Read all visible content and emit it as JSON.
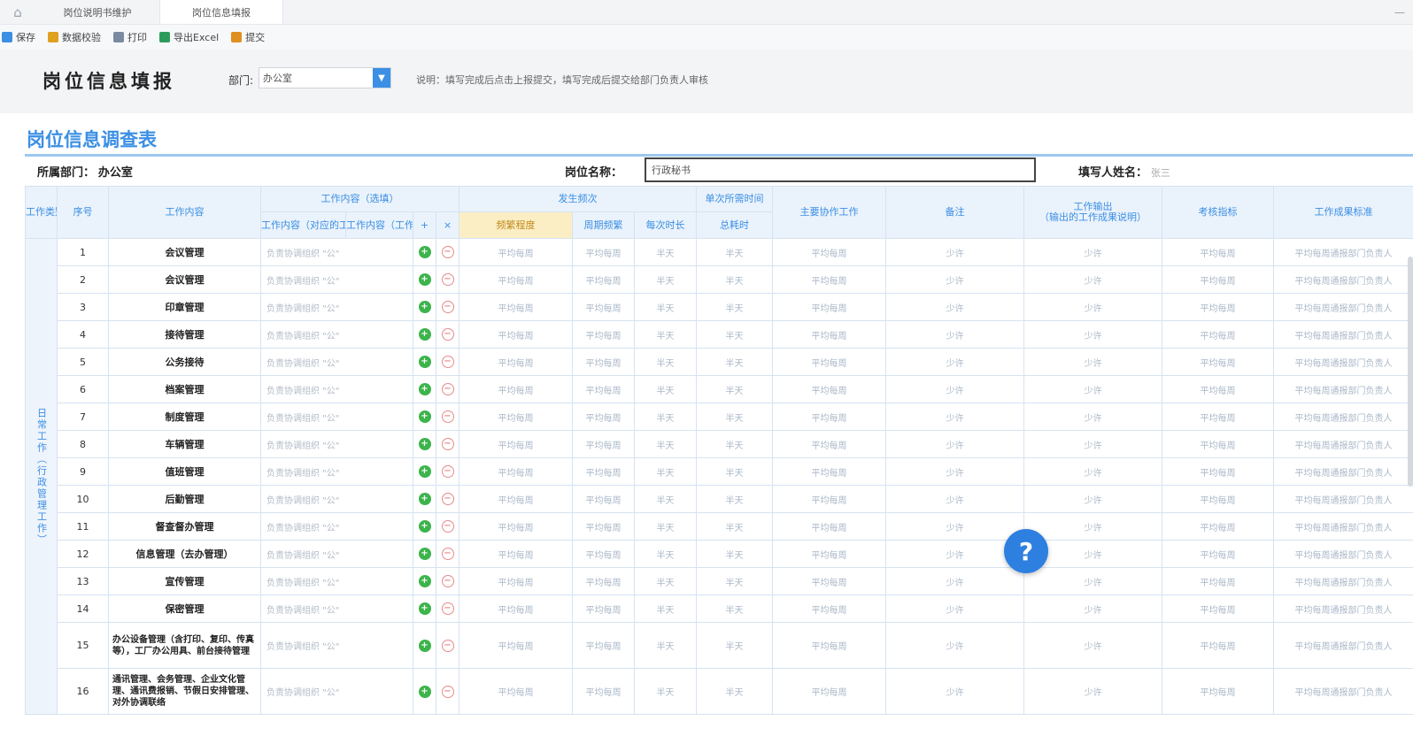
{
  "tabs": [
    {
      "label": "岗位说明书维护"
    },
    {
      "label": "岗位信息填报"
    }
  ],
  "toolbar": [
    {
      "label": "保存",
      "color": "#3b8fe4"
    },
    {
      "label": "数据校验",
      "color": "#e0a020"
    },
    {
      "label": "打印",
      "color": "#7a8aa0"
    },
    {
      "label": "导出Excel",
      "color": "#2e9b5b"
    },
    {
      "label": "提交",
      "color": "#e09020"
    }
  ],
  "filter": {
    "title": "岗位信息填报",
    "dept_label": "部门:",
    "dept_value": "办公室",
    "hint": "说明：填写完成后点击上报提交，填写完成后提交给部门负责人审核"
  },
  "form": {
    "title": "岗位信息调查表",
    "dept_label": "所属部门：",
    "dept_value": "办公室",
    "post_label": "岗位名称：",
    "post_value": "行政秘书",
    "filler_label": "填写人姓名：",
    "filler_value": "张三"
  },
  "table": {
    "headers": {
      "group": "工作类别",
      "seq": "序号",
      "content": "工作内容",
      "detail_top": "工作内容（选填）",
      "detail_a": "工作内容（对应的工作）",
      "detail_b": "工作内容（工作描述）",
      "add": "+",
      "del": "×",
      "freq_top": "发生频次",
      "freq_a": "频繁程度",
      "freq_b": "周期频繁",
      "freq_c": "每次时长",
      "load_top": "单次所需时间",
      "load_sub": "总耗时",
      "related": "主要协作工作",
      "remark": "备注",
      "result_top": "工作输出",
      "result_sub": "（输出的工作成果说明）",
      "assess": "考核指标",
      "result": "工作成果标准"
    },
    "group_label": "日常工作（行政管理工作）",
    "rows": [
      {
        "seq": "1",
        "name": "会议管理",
        "desc": "负责协调组织 \"公\""
      },
      {
        "seq": "2",
        "name": "会议管理",
        "desc": "负责协调组织 \"公\""
      },
      {
        "seq": "3",
        "name": "印章管理",
        "desc": "负责协调组织 \"公\""
      },
      {
        "seq": "4",
        "name": "接待管理",
        "desc": "负责协调组织 \"公\""
      },
      {
        "seq": "5",
        "name": "公务接待",
        "desc": "负责协调组织 \"公\""
      },
      {
        "seq": "6",
        "name": "档案管理",
        "desc": "负责协调组织 \"公\""
      },
      {
        "seq": "7",
        "name": "制度管理",
        "desc": "负责协调组织 \"公\""
      },
      {
        "seq": "8",
        "name": "车辆管理",
        "desc": "负责协调组织 \"公\""
      },
      {
        "seq": "9",
        "name": "值班管理",
        "desc": "负责协调组织 \"公\""
      },
      {
        "seq": "10",
        "name": "后勤管理",
        "desc": "负责协调组织 \"公\""
      },
      {
        "seq": "11",
        "name": "督查督办管理",
        "desc": "负责协调组织 \"公\""
      },
      {
        "seq": "12",
        "name": "信息管理（去办管理）",
        "desc": "负责协调组织 \"公\""
      },
      {
        "seq": "13",
        "name": "宣传管理",
        "desc": "负责协调组织 \"公\""
      },
      {
        "seq": "14",
        "name": "保密管理",
        "desc": "负责协调组织 \"公\""
      }
    ],
    "tall_rows": [
      {
        "seq": "15",
        "name": "办公设备管理（含打印、复印、传真等），工厂办公用具、前台接待管理",
        "desc": "负责协调组织 \"公\""
      },
      {
        "seq": "16",
        "name": "通讯管理、会务管理、企业文化管理、通讯费报销、节假日安排管理、对外协调联络",
        "desc": "负责协调组织 \"公\""
      }
    ],
    "cells": {
      "freq_a": "平均每周",
      "freq_b": "平均每周",
      "freq_c": "半天",
      "load": "半天",
      "related": "平均每周",
      "remark": "少许",
      "result": "少许",
      "assess": "平均每周",
      "standard": "平均每周通报部门负责人"
    }
  },
  "help_label": "?"
}
